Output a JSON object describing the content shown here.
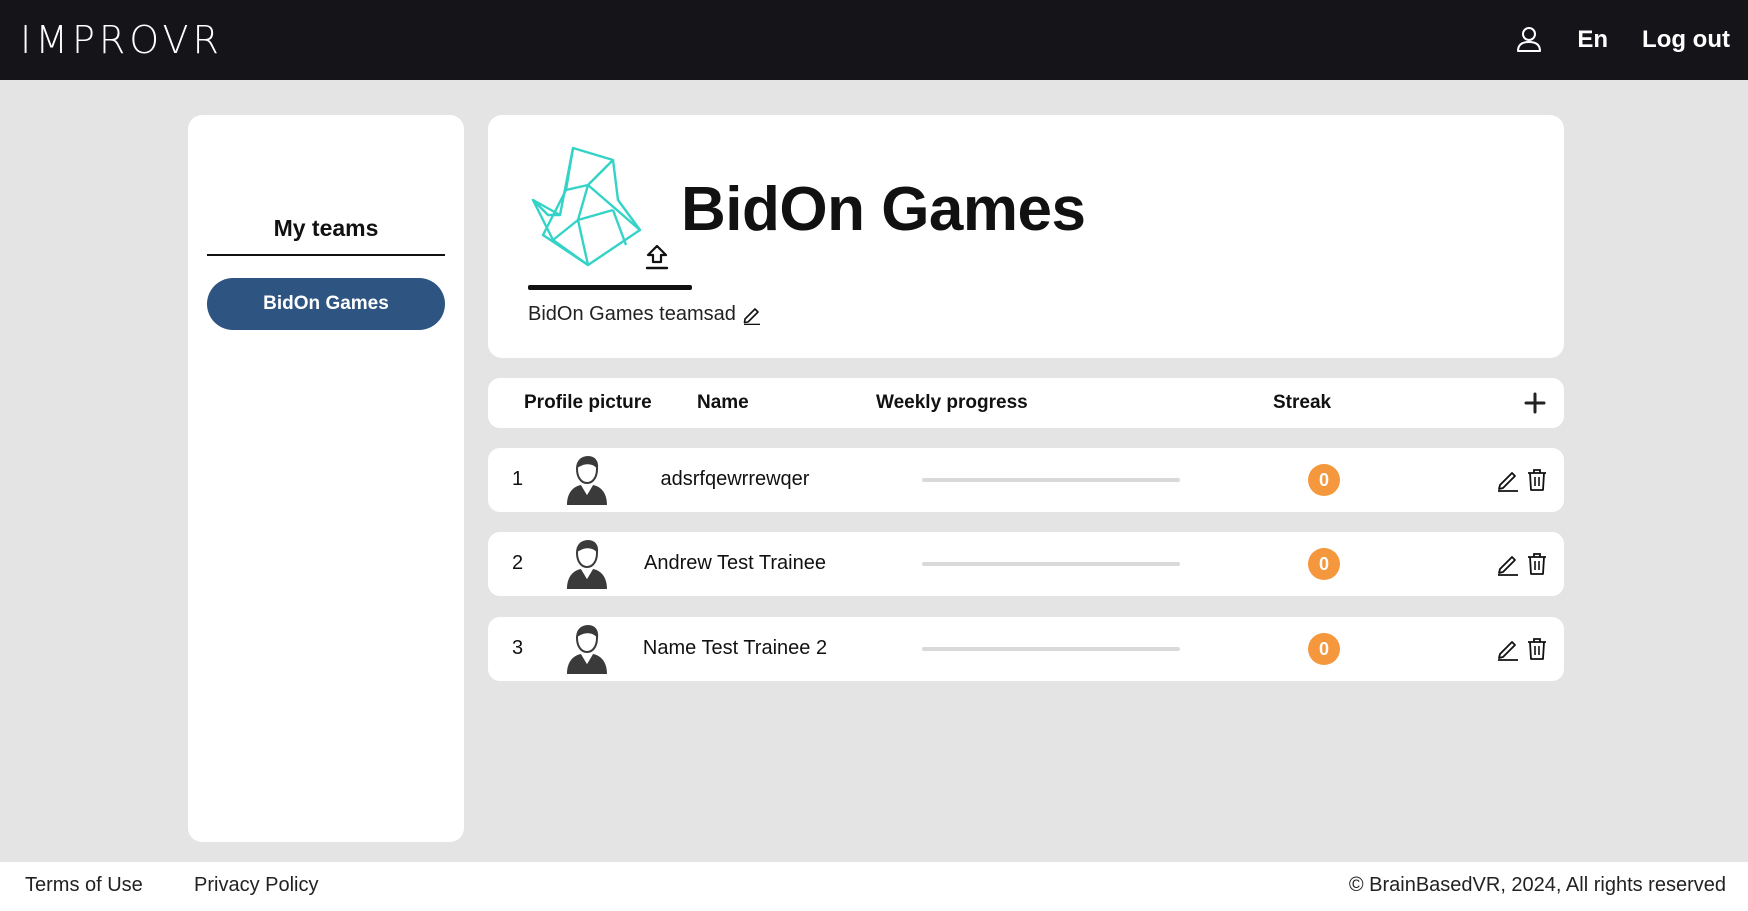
{
  "header": {
    "logo": "IMPROVR",
    "language": "En",
    "logout_label": "Log out"
  },
  "sidebar": {
    "title": "My teams",
    "teams": [
      {
        "label": "BidOn Games"
      }
    ]
  },
  "team": {
    "name": "BidOn Games",
    "description": "BidOn Games teamsad"
  },
  "table": {
    "columns": [
      "Profile picture",
      "Name",
      "Weekly progress",
      "Streak"
    ],
    "rows": [
      {
        "index": "1",
        "name": "adsrfqewrrewqer",
        "weekly_progress": 0,
        "streak": "0"
      },
      {
        "index": "2",
        "name": "Andrew Test Trainee",
        "weekly_progress": 0,
        "streak": "0"
      },
      {
        "index": "3",
        "name": "Name Test Trainee 2",
        "weekly_progress": 0,
        "streak": "0"
      }
    ]
  },
  "footer": {
    "terms": "Terms of Use",
    "privacy": "Privacy Policy",
    "copyright": "© BrainBasedVR, 2024, All rights reserved"
  },
  "colors": {
    "header_bg": "#141419",
    "accent": "#2e5481",
    "streak": "#f5973c",
    "logo_teal": "#34d3c7"
  }
}
